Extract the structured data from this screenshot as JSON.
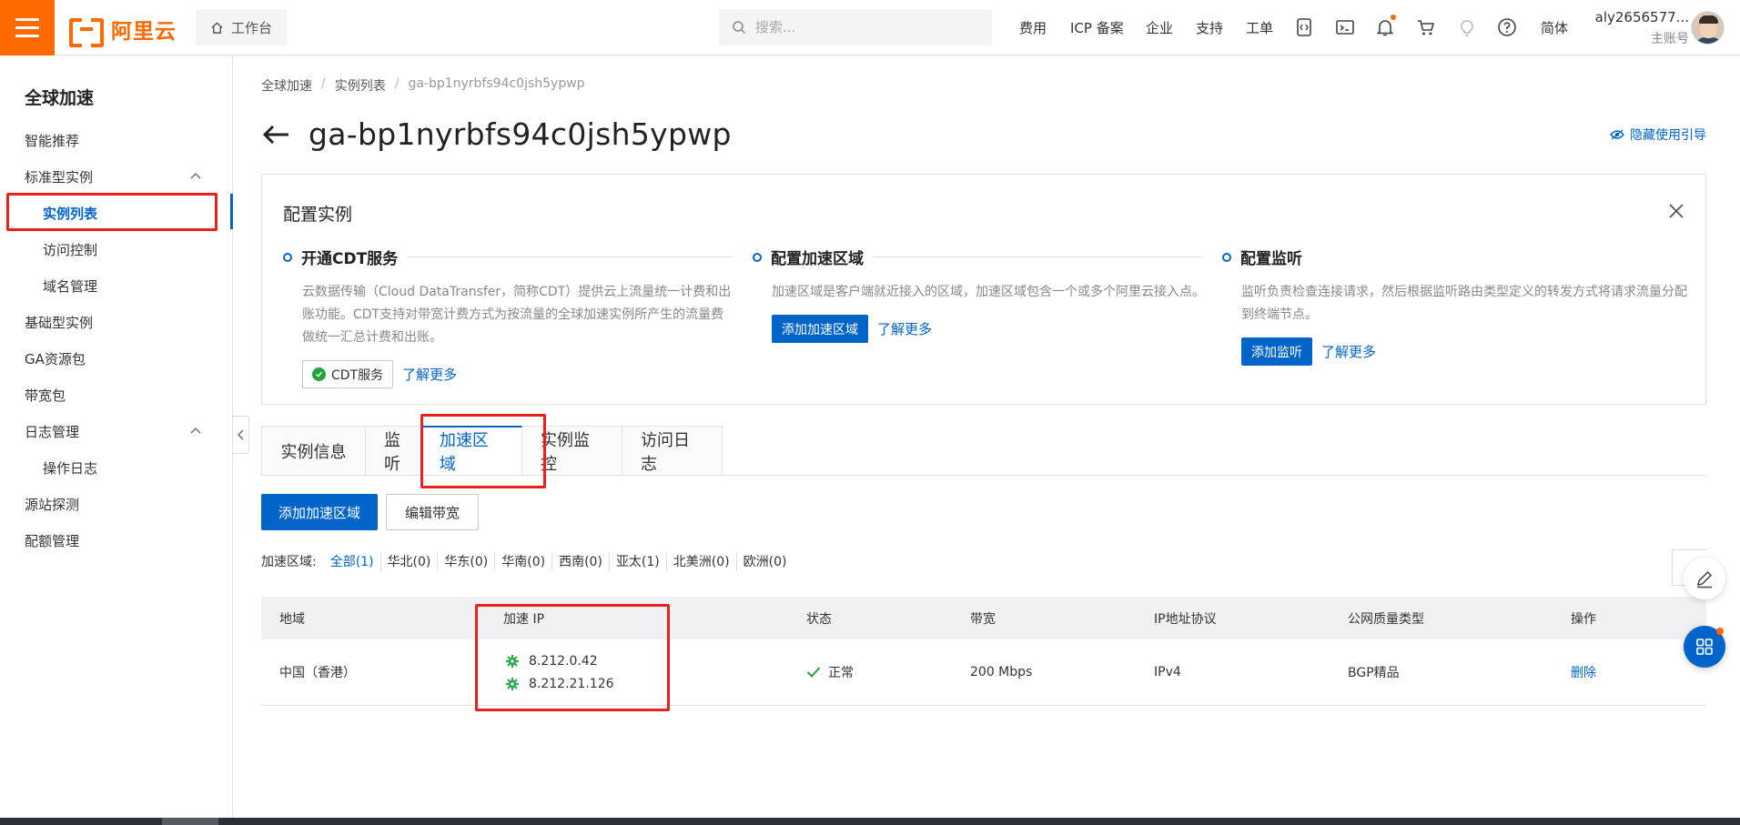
{
  "topbar": {
    "logo_text": "阿里云",
    "workbench": "工作台",
    "search_placeholder": "搜索...",
    "nav": [
      "费用",
      "ICP 备案",
      "企业",
      "支持",
      "工单"
    ],
    "lang": "简体",
    "user_name": "aly2656577...",
    "user_role": "主账号",
    "brand_color": "#ff6a00"
  },
  "sidebar": {
    "title": "全球加速",
    "items": [
      {
        "label": "智能推荐"
      },
      {
        "label": "标准型实例"
      },
      {
        "label": "实例列表"
      },
      {
        "label": "访问控制"
      },
      {
        "label": "域名管理"
      },
      {
        "label": "基础型实例"
      },
      {
        "label": "GA资源包"
      },
      {
        "label": "带宽包"
      },
      {
        "label": "日志管理"
      },
      {
        "label": "操作日志"
      },
      {
        "label": "源站探测"
      },
      {
        "label": "配额管理"
      }
    ]
  },
  "breadcrumb": [
    "全球加速",
    "实例列表",
    "ga-bp1nyrbfs94c0jsh5ypwp"
  ],
  "page": {
    "title": "ga-bp1nyrbfs94c0jsh5ypwp",
    "hide_guide": "隐藏使用引导",
    "accent_color": "#0064c8"
  },
  "config_card": {
    "title": "配置实例",
    "steps": [
      {
        "title": "开通CDT服务",
        "desc": "云数据传输（Cloud DataTransfer，简称CDT）提供云上流量统一计费和出账功能。CDT支持对带宽计费方式为按流量的全球加速实例所产生的流量费做统一汇总计费和出账。",
        "button": "CDT服务",
        "link": "了解更多"
      },
      {
        "title": "配置加速区域",
        "desc": "加速区域是客户端就近接入的区域，加速区域包含一个或多个阿里云接入点。",
        "button": "添加加速区域",
        "link": "了解更多"
      },
      {
        "title": "配置监听",
        "desc": "监听负责检查连接请求，然后根据监听路由类型定义的转发方式将请求流量分配到终端节点。",
        "button": "添加监听",
        "link": "了解更多"
      }
    ]
  },
  "tabs": [
    "实例信息",
    "监听",
    "加速区域",
    "实例监控",
    "访问日志"
  ],
  "actions": {
    "add": "添加加速区域",
    "edit": "编辑带宽"
  },
  "filter": {
    "label": "加速区域:",
    "items": [
      "全部(1)",
      "华北(0)",
      "华东(0)",
      "华南(0)",
      "西南(0)",
      "亚太(1)",
      "北美洲(0)",
      "欧洲(0)"
    ]
  },
  "table": {
    "headers": [
      "地域",
      "加速 IP",
      "状态",
      "带宽",
      "IP地址协议",
      "公网质量类型",
      "操作"
    ],
    "rows": [
      {
        "region": "中国（香港）",
        "ips": [
          "8.212.0.42",
          "8.212.21.126"
        ],
        "status": "正常",
        "bandwidth": "200 Mbps",
        "protocol": "IPv4",
        "quality": "BGP精品",
        "action": "删除"
      }
    ]
  }
}
